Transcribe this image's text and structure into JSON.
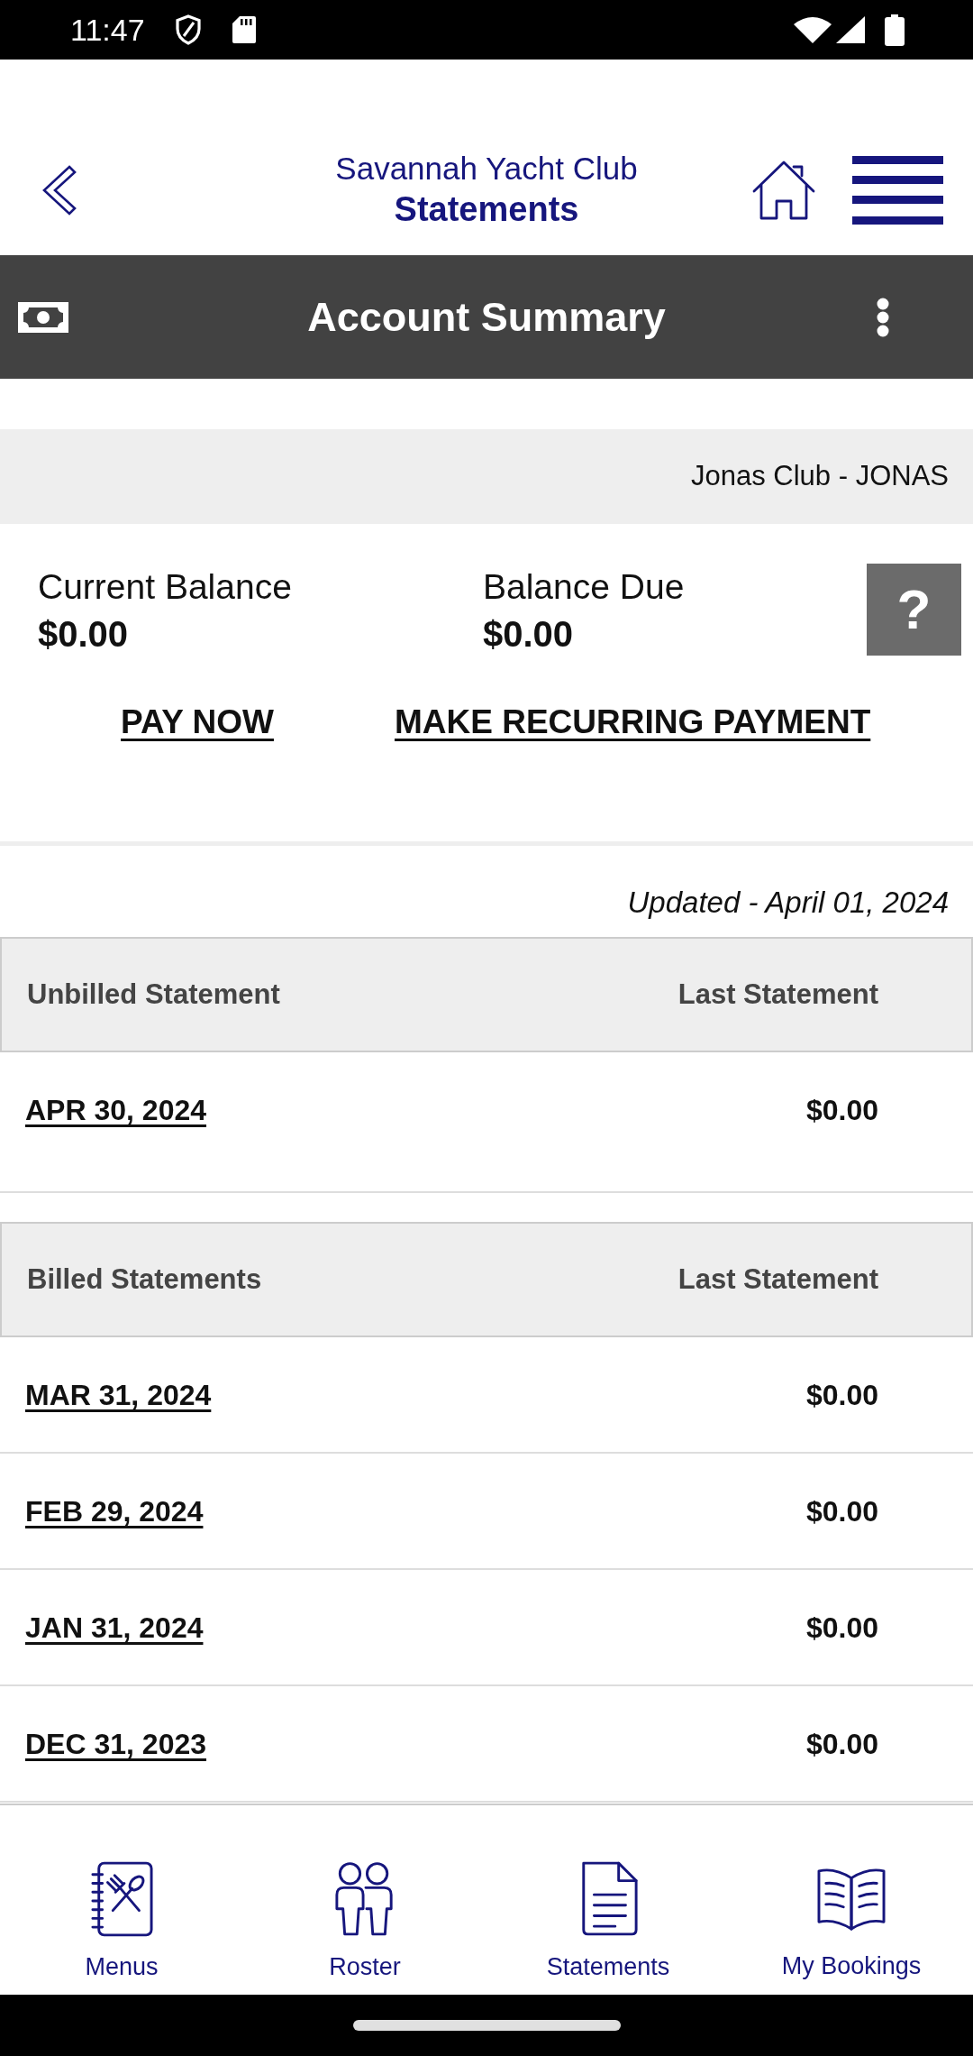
{
  "status_bar": {
    "time": "11:47"
  },
  "header": {
    "club": "Savannah Yacht Club",
    "title": "Statements"
  },
  "section": {
    "title": "Account Summary"
  },
  "club_account": "Jonas Club - JONAS",
  "balances": [
    {
      "label": "Current Balance",
      "amount": "$0.00"
    },
    {
      "label": "Balance Due",
      "amount": "$0.00"
    }
  ],
  "help_button": "?",
  "actions": [
    "PAY NOW",
    "MAKE RECURRING PAYMENT"
  ],
  "updated": "Updated - April 01, 2024",
  "tables": [
    {
      "columns": [
        "Unbilled Statement",
        "Last Statement"
      ],
      "rows": [
        {
          "date": "APR 30, 2024",
          "amount": "$0.00"
        }
      ]
    },
    {
      "columns": [
        "Billed Statements",
        "Last Statement"
      ],
      "rows": [
        {
          "date": "MAR 31, 2024",
          "amount": "$0.00"
        },
        {
          "date": "FEB 29, 2024",
          "amount": "$0.00"
        },
        {
          "date": "JAN 31, 2024",
          "amount": "$0.00"
        },
        {
          "date": "DEC 31, 2023",
          "amount": "$0.00"
        }
      ]
    }
  ],
  "bottom_nav": [
    {
      "label": "Menus",
      "kind": "dining"
    },
    {
      "label": "Roster",
      "kind": "people"
    },
    {
      "label": "Statements",
      "kind": "document"
    },
    {
      "label": "My Bookings",
      "kind": "book"
    }
  ]
}
